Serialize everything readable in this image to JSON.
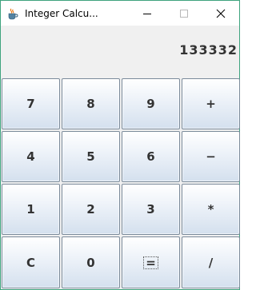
{
  "window": {
    "title": "Integer Calcu...",
    "icons": {
      "app": "java-cup-icon",
      "minimize": "minimize-icon",
      "maximize": "maximize-icon",
      "close": "close-icon"
    },
    "border_color": "#3ea37e"
  },
  "display": {
    "value": "133332"
  },
  "keypad": {
    "keys": [
      {
        "id": "7",
        "label": "7"
      },
      {
        "id": "8",
        "label": "8"
      },
      {
        "id": "9",
        "label": "9"
      },
      {
        "id": "plus",
        "label": "+"
      },
      {
        "id": "4",
        "label": "4"
      },
      {
        "id": "5",
        "label": "5"
      },
      {
        "id": "6",
        "label": "6"
      },
      {
        "id": "minus",
        "label": "−"
      },
      {
        "id": "1",
        "label": "1"
      },
      {
        "id": "2",
        "label": "2"
      },
      {
        "id": "3",
        "label": "3"
      },
      {
        "id": "multiply",
        "label": "*"
      },
      {
        "id": "clear",
        "label": "C"
      },
      {
        "id": "0",
        "label": "0"
      },
      {
        "id": "equals",
        "label": "=",
        "focused": true
      },
      {
        "id": "divide",
        "label": "/"
      }
    ]
  }
}
